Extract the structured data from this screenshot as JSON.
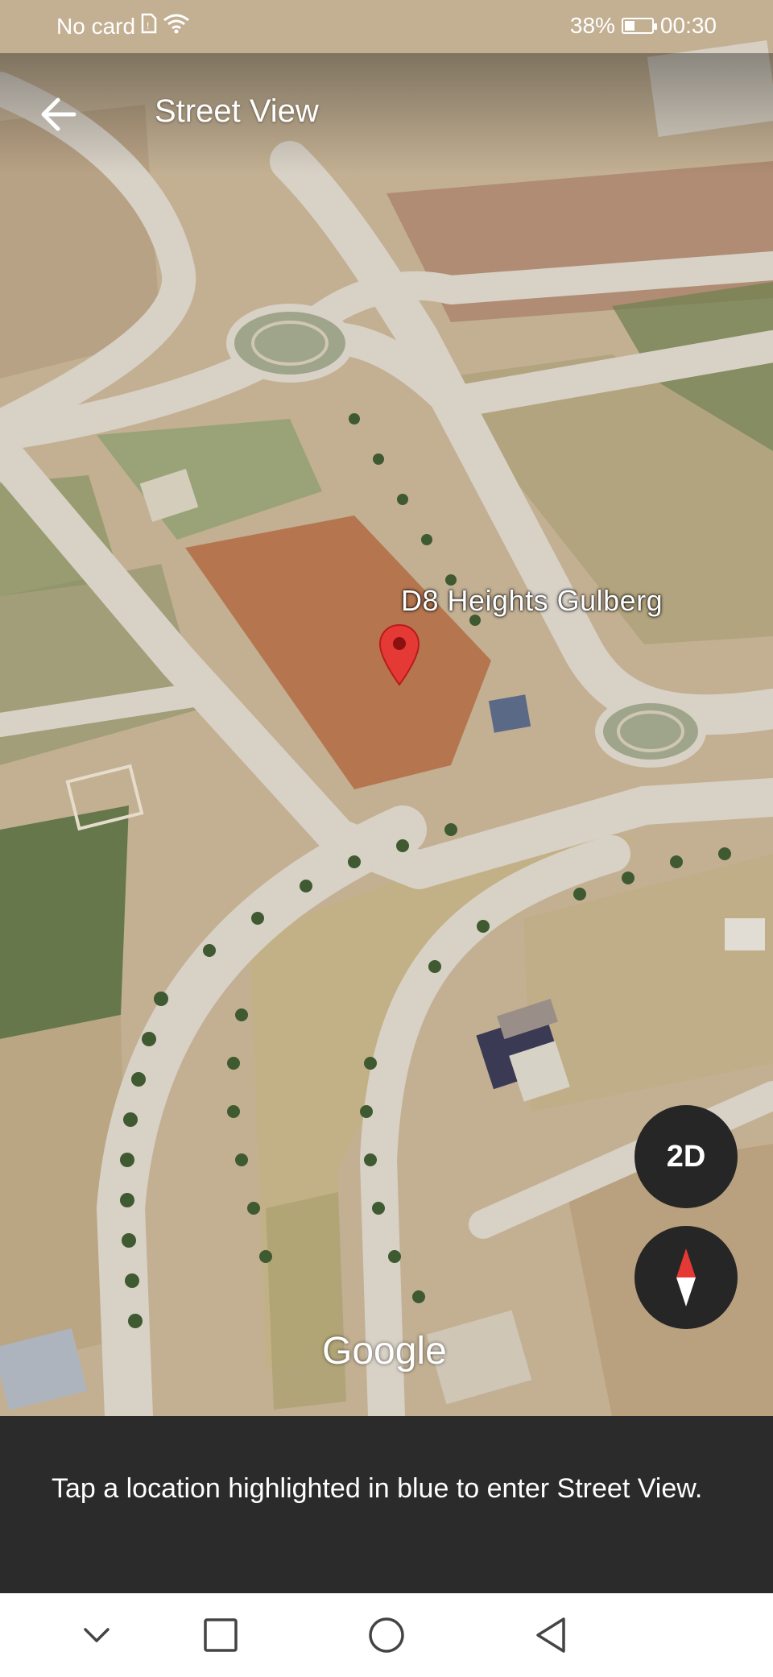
{
  "status_bar": {
    "carrier": "No card",
    "battery_percent": "38%",
    "battery_level": 0.38,
    "time": "00:30",
    "icons": [
      "sim-icon",
      "wifi-icon",
      "battery-icon"
    ]
  },
  "app_bar": {
    "title": "Street View",
    "back_icon": "arrow-left-icon"
  },
  "map": {
    "place_label": "D8 Heights Gulberg",
    "attribution": "Google",
    "marker_icon": "map-pin-icon",
    "marker_color": "#e53935"
  },
  "controls": {
    "view_toggle_label": "2D",
    "compass_icon": "compass-icon"
  },
  "info_sheet": {
    "message": "Tap a location highlighted in blue to enter Street View."
  },
  "nav_bar": {
    "icons": [
      "chevron-down-icon",
      "square-icon",
      "circle-icon",
      "triangle-back-icon"
    ]
  }
}
